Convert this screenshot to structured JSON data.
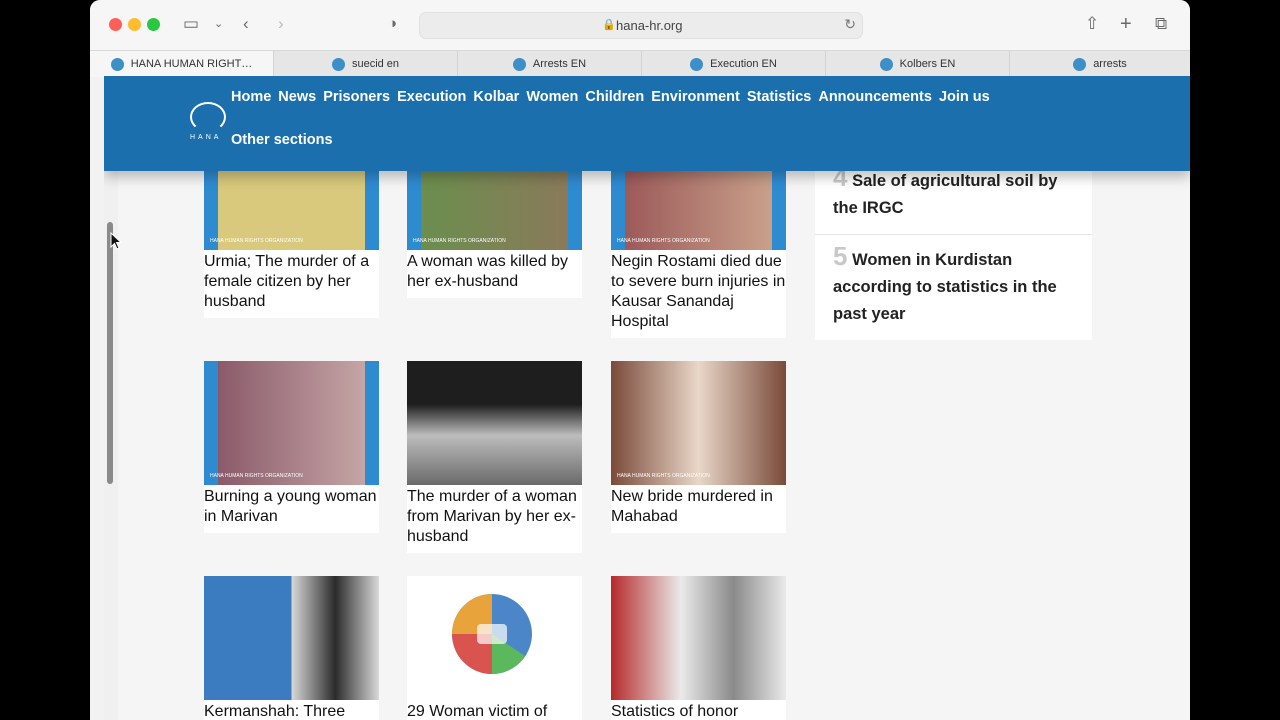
{
  "browser": {
    "url": "hana-hr.org",
    "tabs": [
      {
        "label": "HANA HUMAN RIGHT…",
        "active": true
      },
      {
        "label": "suecid en",
        "active": false
      },
      {
        "label": "Arrests EN",
        "active": false
      },
      {
        "label": "Execution EN",
        "active": false
      },
      {
        "label": "Kolbers EN",
        "active": false
      },
      {
        "label": "arrests",
        "active": false
      }
    ]
  },
  "logo": {
    "text": "HANA"
  },
  "nav": {
    "items": [
      "Home",
      "News",
      "Prisoners",
      "Execution",
      "Kolbar",
      "Women",
      "Children",
      "Environment",
      "Statistics",
      "Announcements",
      "Join us"
    ],
    "other": "Other sections"
  },
  "articles": [
    {
      "caption": "Urmia; The murder of a female citizen by her husband",
      "colors": [
        "#2e8bd0",
        "#d9c97c"
      ]
    },
    {
      "caption": "A woman was killed by her ex-husband",
      "colors": [
        "#2e8bd0",
        "#6b8e4e"
      ]
    },
    {
      "caption": "Negin Rostami died due to severe burn injuries in Kausar Sanandaj Hospital",
      "colors": [
        "#2e8bd0",
        "#9c5a5a"
      ]
    },
    {
      "caption": "Burning a young woman in Marivan",
      "colors": [
        "#2e8bd0",
        "#8a5a6a"
      ]
    },
    {
      "caption": "The murder of a woman from Marivan by her ex-husband",
      "colors": [
        "#2a2a2a",
        "#bdbdbd"
      ]
    },
    {
      "caption": "New bride murdered in Mahabad",
      "colors": [
        "#7a4a3a",
        "#e9d7c8"
      ]
    },
    {
      "caption": "Kermanshah: Three",
      "colors": [
        "#3b7bbf",
        "#2b2b2b"
      ]
    },
    {
      "caption": "29 Woman victim of",
      "colors": [
        "#ffffff",
        "#4a86c8"
      ]
    },
    {
      "caption": "Statistics of honor",
      "colors": [
        "#b52a2a",
        "#eaeaea"
      ]
    }
  ],
  "watermark": "HANA HUMAN RIGHTS ORGANIZATION",
  "sidebar": [
    {
      "num": "4",
      "title": "Sale of agricultural soil by the IRGC"
    },
    {
      "num": "5",
      "title": "Women in Kurdistan according to statistics in the past year"
    }
  ]
}
